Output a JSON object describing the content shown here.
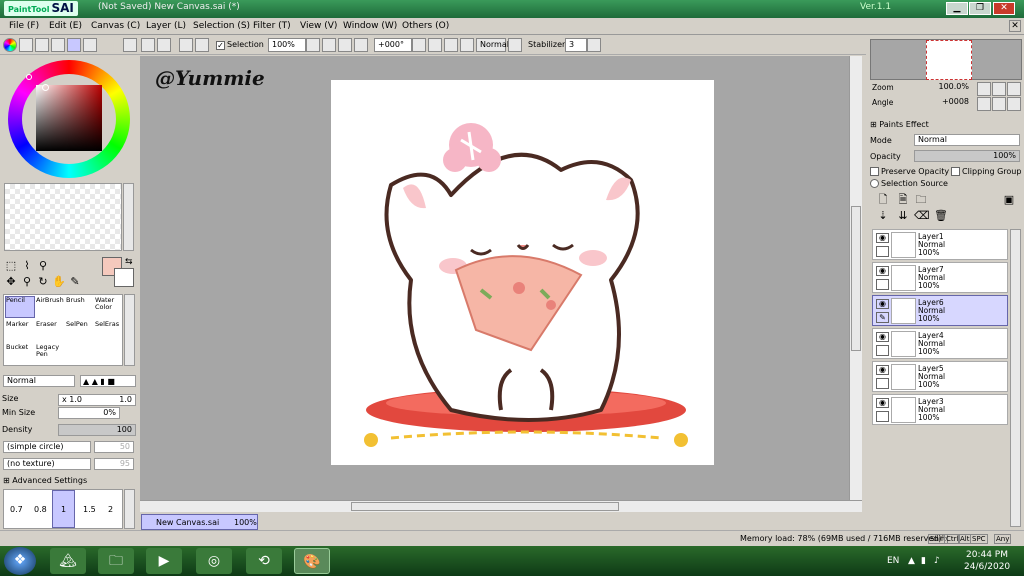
{
  "titlebar": {
    "app_name": "PaintTool SAI",
    "doc_title": "(Not Saved) New Canvas.sai (*)",
    "version": "Ver.1.1",
    "min_btn": "▁",
    "restore_btn": "❐",
    "close_btn": "✕"
  },
  "menu": [
    "File (F)",
    "Edit (E)",
    "Canvas (C)",
    "Layer (L)",
    "Selection (S)",
    "Filter (T)",
    "View (V)",
    "Window (W)",
    "Others (O)"
  ],
  "menu_close": "✕",
  "toolbar": {
    "selection_label": "Selection",
    "zoom_value": "100%",
    "rotation_value": "+000°",
    "blend_value": "Normal",
    "stabilizer_label": "Stabilizer",
    "stabilizer_value": "3"
  },
  "canvas": {
    "watermark": "@Yummie"
  },
  "tools": [
    {
      "label": "Pencil",
      "selected": true
    },
    {
      "label": "AirBrush",
      "selected": false
    },
    {
      "label": "Brush",
      "selected": false
    },
    {
      "label": "Water Color",
      "selected": false
    },
    {
      "label": "Marker",
      "selected": false
    },
    {
      "label": "Eraser",
      "selected": false
    },
    {
      "label": "SelPen",
      "selected": false
    },
    {
      "label": "SelEras",
      "selected": false
    },
    {
      "label": "Bucket",
      "selected": false
    },
    {
      "label": "Legacy Pen",
      "selected": false
    }
  ],
  "brush": {
    "mode": "Normal",
    "size_label": "Size",
    "size_multiplier": "x 1.0",
    "size_value": "1.0",
    "min_size_label": "Min Size",
    "min_size_value": "0%",
    "density_label": "Density",
    "density_value": "100",
    "shape": "(simple circle)",
    "shape_value": "50",
    "texture": "(no texture)",
    "texture_value": "95",
    "advanced": "Advanced Settings",
    "sizes": [
      "0.7",
      "0.8",
      "1",
      "1.5",
      "2"
    ],
    "selected_size": "1"
  },
  "navigator": {
    "zoom_label": "Zoom",
    "zoom_value": "100.0%",
    "angle_label": "Angle",
    "angle_value": "+0008"
  },
  "layers_panel": {
    "paints_effect": "Paints Effect",
    "mode_label": "Mode",
    "mode_value": "Normal",
    "opacity_label": "Opacity",
    "opacity_value": "100%",
    "preserve_opacity": "Preserve Opacity",
    "clipping_group": "Clipping Group",
    "selection_source": "Selection Source",
    "layers": [
      {
        "name": "Layer1",
        "mode": "Normal",
        "opacity": "100%",
        "selected": false
      },
      {
        "name": "Layer7",
        "mode": "Normal",
        "opacity": "100%",
        "selected": false
      },
      {
        "name": "Layer6",
        "mode": "Normal",
        "opacity": "100%",
        "selected": true
      },
      {
        "name": "Layer4",
        "mode": "Normal",
        "opacity": "100%",
        "selected": false
      },
      {
        "name": "Layer5",
        "mode": "Normal",
        "opacity": "100%",
        "selected": false
      },
      {
        "name": "Layer3",
        "mode": "Normal",
        "opacity": "100%",
        "selected": false
      }
    ]
  },
  "doc_tab": {
    "name": "New Canvas.sai",
    "zoom": "100%"
  },
  "status": {
    "memory": "Memory load: 78% (69MB used / 716MB reserved)",
    "keys": [
      "Shift",
      "Ctrl",
      "Alt",
      "SPC",
      "Any"
    ]
  },
  "taskbar": {
    "lang": "EN",
    "time": "20:44 PM",
    "date": "24/6/2020"
  },
  "colors": {
    "accent_selected": "#c8c8ff",
    "foreground_color": "#f5c9bd",
    "background_color": "#ffffff"
  }
}
